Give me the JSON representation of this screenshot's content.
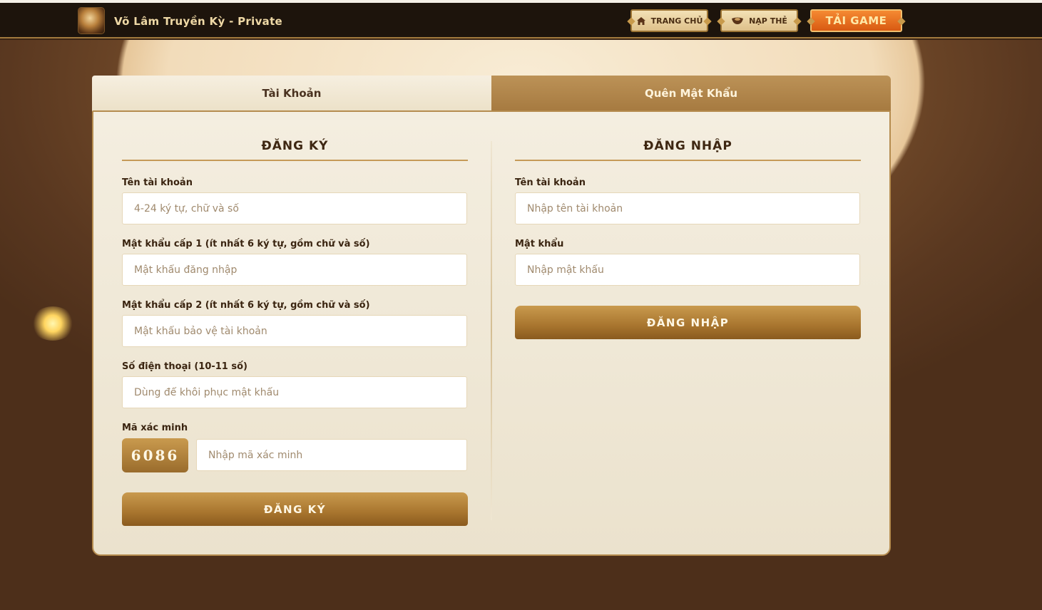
{
  "header": {
    "title": "Võ Lâm Truyền Kỳ - Private",
    "nav": {
      "home_label": "TRANG CHỦ",
      "topup_label": "NẠP THẺ",
      "download_label": "TẢI GAME"
    }
  },
  "tabs": {
    "account_label": "Tài Khoản",
    "forgot_label": "Quên Mật Khẩu"
  },
  "register": {
    "title": "ĐĂNG KÝ",
    "username_label": "Tên tài khoản",
    "username_placeholder": "4-24 ký tự, chữ và số",
    "password1_label": "Mật khẩu cấp 1 (ít nhất 6 ký tự, gồm chữ và số)",
    "password1_placeholder": "Mật khẩu đăng nhập",
    "password2_label": "Mật khẩu cấp 2 (ít nhất 6 ký tự, gồm chữ và số)",
    "password2_placeholder": "Mật khẩu bảo vệ tài khoản",
    "phone_label": "Số điện thoại (10-11 số)",
    "phone_placeholder": "Dùng để khôi phục mật khẩu",
    "captcha_label": "Mã xác minh",
    "captcha_code": "6086",
    "captcha_placeholder": "Nhập mã xác minh",
    "submit_label": "ĐĂNG KÝ"
  },
  "login": {
    "title": "ĐĂNG NHẬP",
    "username_label": "Tên tài khoản",
    "username_placeholder": "Nhập tên tài khoản",
    "password_label": "Mật khẩu",
    "password_placeholder": "Nhập mật khẩu",
    "submit_label": "ĐĂNG NHẬP"
  },
  "colors": {
    "accent_gold": "#b58c4f",
    "download_orange": "#e8701c",
    "header_bg": "#1d140c"
  }
}
